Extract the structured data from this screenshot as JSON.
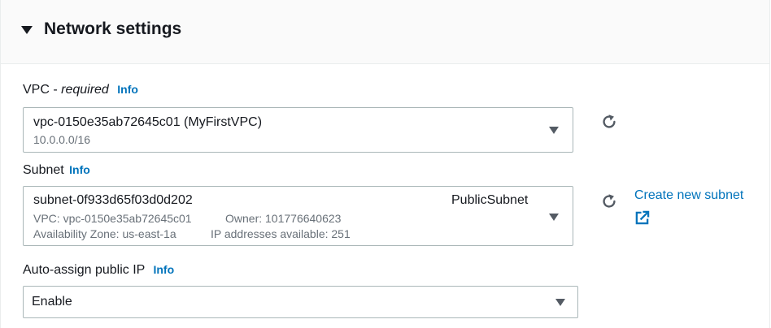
{
  "section": {
    "title": "Network settings"
  },
  "vpc": {
    "label": "VPC",
    "label_sep": " - ",
    "required": "required",
    "info": "Info",
    "value": "vpc-0150e35ab72645c01 (MyFirstVPC)",
    "cidr": "10.0.0.0/16"
  },
  "subnet": {
    "label": "Subnet",
    "info": "Info",
    "value": "subnet-0f933d65f03d0d202",
    "name": "PublicSubnet",
    "vpc_detail": "VPC: vpc-0150e35ab72645c01",
    "owner_detail": "Owner: 101776640623",
    "az_detail": "Availability Zone: us-east-1a",
    "ip_detail": "IP addresses available: 251",
    "create_link": "Create new subnet"
  },
  "public_ip": {
    "label": "Auto-assign public IP",
    "info": "Info",
    "value": "Enable"
  },
  "icons": {
    "section_toggle": "caret-down-icon",
    "dropdown": "caret-down-icon",
    "refresh": "refresh-icon",
    "external": "external-link-icon"
  },
  "colors": {
    "link": "#0073bb",
    "text": "#16191f",
    "secondary_text": "#687078",
    "border": "#aab7b8",
    "header_bg": "#fafafa"
  }
}
